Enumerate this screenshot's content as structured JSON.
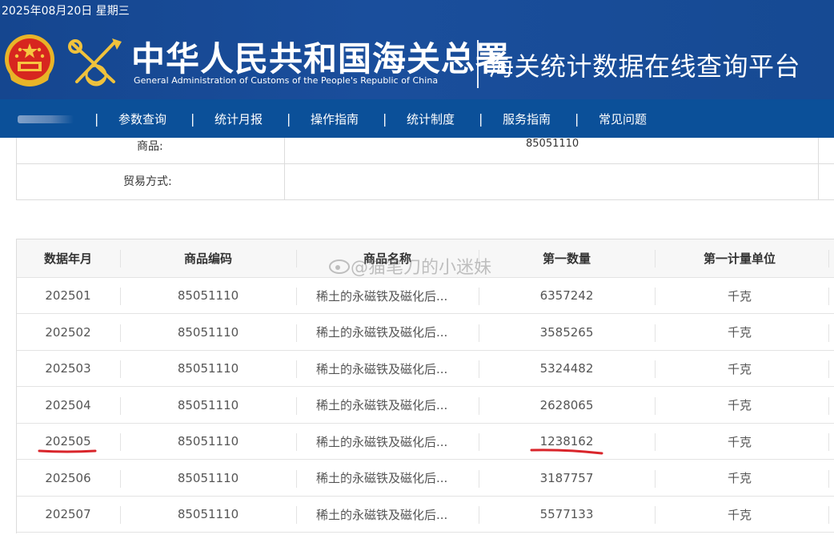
{
  "header": {
    "date": "2025年08月20日 星期三",
    "org_name_cn": "中华人民共和国海关总署",
    "org_name_en": "General Administration of Customs of the People's Republic of China",
    "platform_title": "海关统计数据在线查询平台",
    "emblem_icon": "national-emblem-icon",
    "logo_icon": "customs-emblem-icon",
    "bg_color": "#1a4e9c"
  },
  "nav": {
    "bg_color": "#0b5099",
    "items": [
      {
        "label": "参数查询"
      },
      {
        "label": "统计月报"
      },
      {
        "label": "操作指南"
      },
      {
        "label": "统计制度"
      },
      {
        "label": "服务指南"
      },
      {
        "label": "常见问题"
      }
    ]
  },
  "criteria": {
    "goods_label": "商品:",
    "goods_value": "85051110",
    "trade_mode_label": "贸易方式:",
    "trade_mode_value": ""
  },
  "results": {
    "columns": [
      "数据年月",
      "商品编码",
      "商品名称",
      "第一数量",
      "第一计量单位"
    ],
    "rows": [
      {
        "month": "202501",
        "code": "85051110",
        "name": "稀土的永磁铁及磁化后...",
        "qty": "6357242",
        "unit": "千克"
      },
      {
        "month": "202502",
        "code": "85051110",
        "name": "稀土的永磁铁及磁化后...",
        "qty": "3585265",
        "unit": "千克"
      },
      {
        "month": "202503",
        "code": "85051110",
        "name": "稀土的永磁铁及磁化后...",
        "qty": "5324482",
        "unit": "千克"
      },
      {
        "month": "202504",
        "code": "85051110",
        "name": "稀土的永磁铁及磁化后...",
        "qty": "2628065",
        "unit": "千克"
      },
      {
        "month": "202505",
        "code": "85051110",
        "name": "稀土的永磁铁及磁化后...",
        "qty": "1238162",
        "unit": "千克"
      },
      {
        "month": "202506",
        "code": "85051110",
        "name": "稀土的永磁铁及磁化后...",
        "qty": "3187757",
        "unit": "千克"
      },
      {
        "month": "202507",
        "code": "85051110",
        "name": "稀土的永磁铁及磁化后...",
        "qty": "5577133",
        "unit": "千克"
      }
    ],
    "highlight_color": "#d9252b"
  },
  "watermark": {
    "text": "@猫笔刀的小迷妹"
  }
}
